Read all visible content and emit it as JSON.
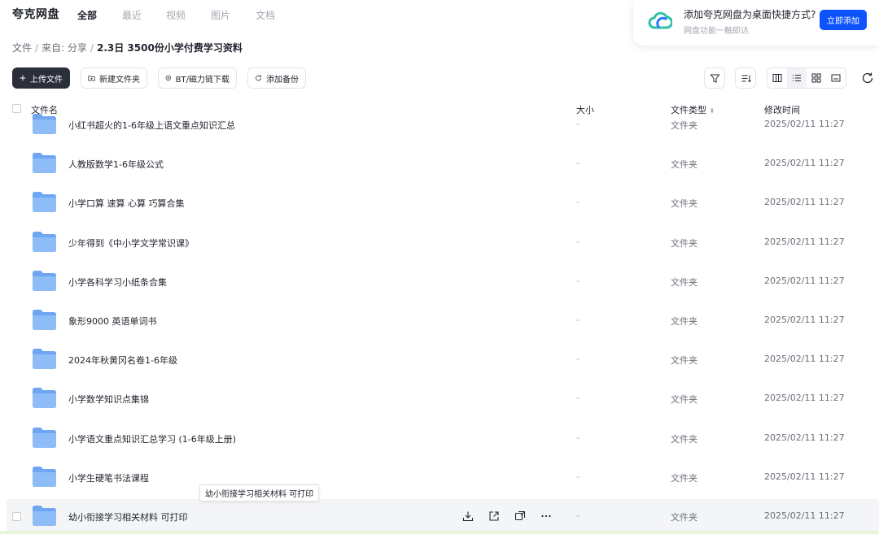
{
  "app": {
    "brand": "夸克网盘"
  },
  "nav": {
    "tabs": [
      "全部",
      "最近",
      "视频",
      "图片",
      "文档"
    ]
  },
  "promo": {
    "title": "添加夸克网盘为桌面快捷方式?",
    "subtitle": "网盘功能一触即达",
    "button": "立即添加",
    "icon": "cloud-icon"
  },
  "breadcrumb": {
    "root": "文件",
    "from": "来自:",
    "share": "分享",
    "current": "2.3日 3500份小学付费学习资料"
  },
  "toolbar": {
    "upload": "上传文件",
    "new_folder": "新建文件夹",
    "bt_download": "BT/磁力链下载",
    "add_backup": "添加备份"
  },
  "table": {
    "headers": {
      "name": "文件名",
      "size": "大小",
      "type": "文件类型",
      "modified": "修改时间"
    },
    "rows": [
      {
        "name": "小红书超火的1-6年级上语文重点知识汇总",
        "size": "-",
        "type": "文件夹",
        "modified": "2025/02/11 11:27"
      },
      {
        "name": "人教版数学1-6年级公式",
        "size": "-",
        "type": "文件夹",
        "modified": "2025/02/11 11:27"
      },
      {
        "name": "小学口算 速算 心算 巧算合集",
        "size": "-",
        "type": "文件夹",
        "modified": "2025/02/11 11:27"
      },
      {
        "name": "少年得到《中小学文学常识课》",
        "size": "-",
        "type": "文件夹",
        "modified": "2025/02/11 11:27"
      },
      {
        "name": "小学各科学习小纸条合集",
        "size": "-",
        "type": "文件夹",
        "modified": "2025/02/11 11:27"
      },
      {
        "name": "象形9000 英语单词书",
        "size": "-",
        "type": "文件夹",
        "modified": "2025/02/11 11:27"
      },
      {
        "name": "2024年秋黄冈名卷1-6年级",
        "size": "-",
        "type": "文件夹",
        "modified": "2025/02/11 11:27"
      },
      {
        "name": "小学数学知识点集锦",
        "size": "-",
        "type": "文件夹",
        "modified": "2025/02/11 11:27"
      },
      {
        "name": "小学语文重点知识汇总学习 (1-6年级上册)",
        "size": "-",
        "type": "文件夹",
        "modified": "2025/02/11 11:27"
      },
      {
        "name": "小学生硬笔书法课程",
        "size": "-",
        "type": "文件夹",
        "modified": "2025/02/11 11:27"
      },
      {
        "name": "幼小衔接学习相关材料 可打印",
        "size": "-",
        "type": "文件夹",
        "modified": "2025/02/11 11:27"
      }
    ]
  },
  "tooltip": "幼小衔接学习相关材料 可打印",
  "colors": {
    "accent": "#0d53ff",
    "folder": "#7fb2f5",
    "primary_btn": "#2b2f3a"
  }
}
